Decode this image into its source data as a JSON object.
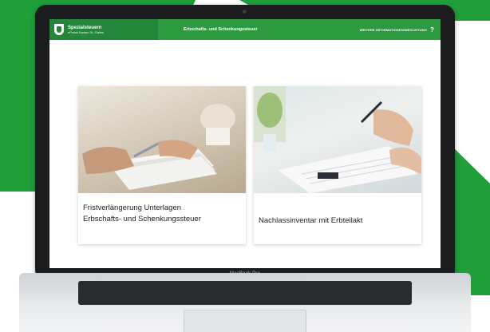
{
  "header": {
    "brand_name": "Spezialsteuern",
    "brand_sub": "ePortal Kanton St. Gallen",
    "center_title": "Erbschafts- und Schenkungssteuer",
    "right_link": "WEITERE INFORMATIONEN/WEGLEITUNG",
    "help_glyph": "?"
  },
  "cards": [
    {
      "title_line1": "Fristverlängerung Unterlagen",
      "title_line2": "Erbschafts- und Schenkungssteuer"
    },
    {
      "title_line1": "Nachlassinventar mit Erbteilakt"
    }
  ],
  "device": {
    "label": "MacBook Pro"
  },
  "colors": {
    "brand_green": "#2e9a40",
    "brand_green_dark": "#23863a",
    "backdrop_green": "#1f9e3a"
  }
}
